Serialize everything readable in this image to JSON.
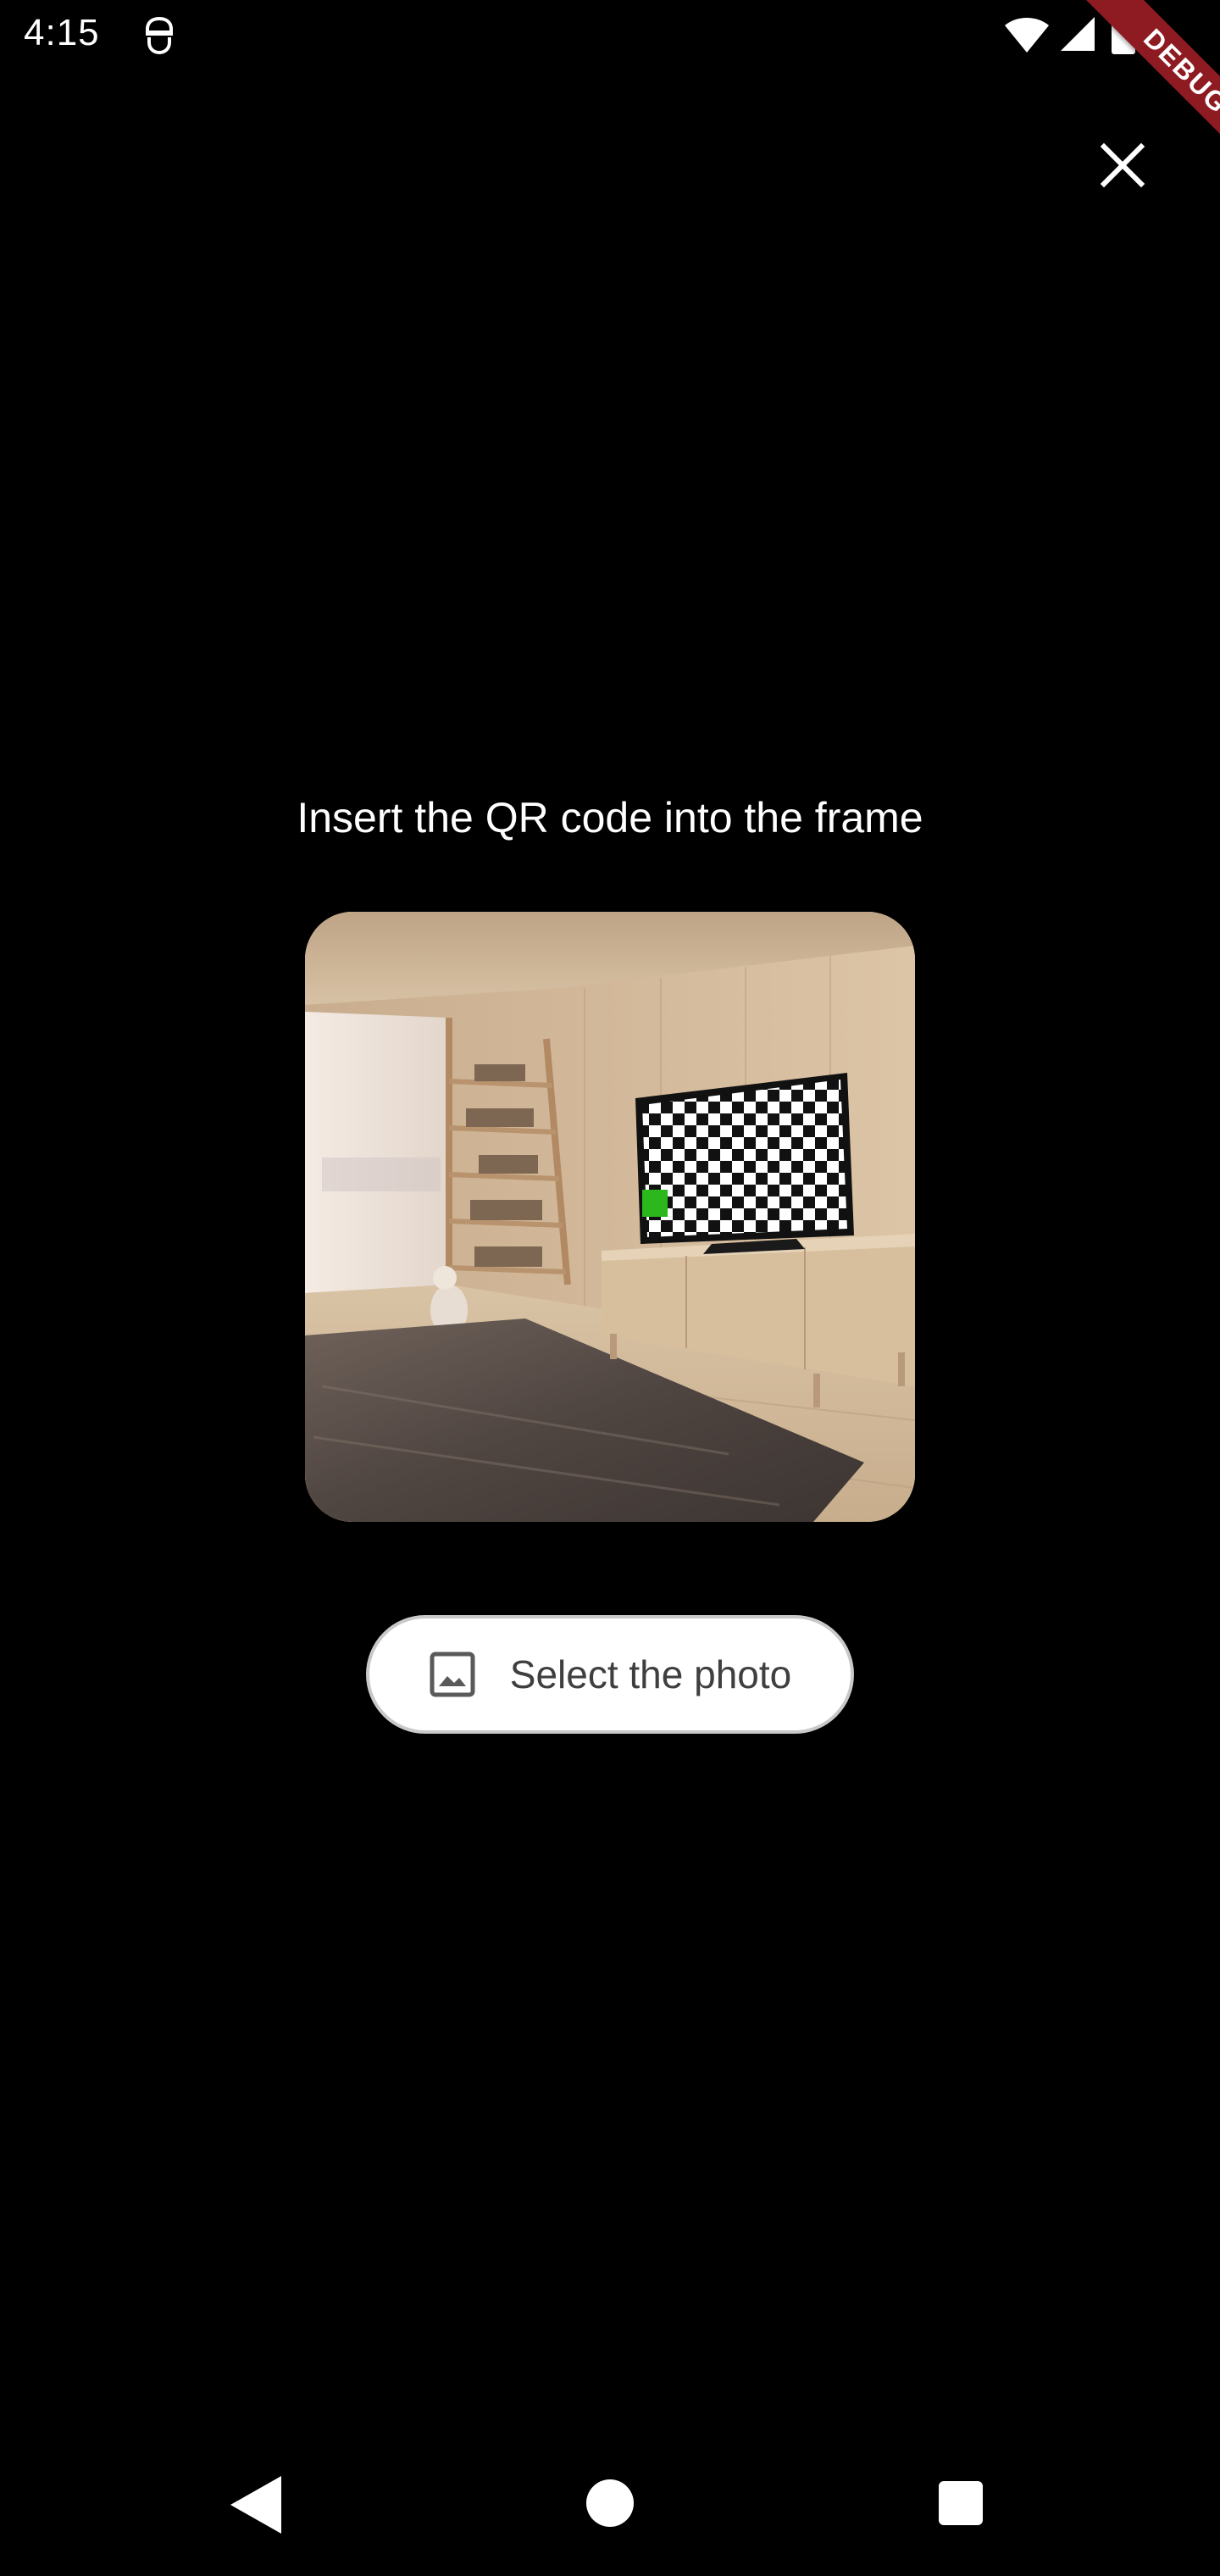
{
  "status_bar": {
    "time": "4:15",
    "icons": [
      "app-notification-icon",
      "wifi-icon",
      "cell-signal-icon",
      "battery-icon"
    ]
  },
  "debug_banner": {
    "label": "DEBUG",
    "color": "#8e1a22"
  },
  "close": {
    "icon": "close-icon"
  },
  "scanner": {
    "title": "Insert the QR code into the frame",
    "preview_description": "Room scene with bookshelf, window, cat, rug and a TV showing a checkerboard pattern"
  },
  "select_photo": {
    "label": "Select the photo",
    "icon": "image-icon"
  },
  "nav_bar": {
    "buttons": [
      "back-icon",
      "home-icon",
      "recents-icon"
    ]
  },
  "colors": {
    "background": "#000000",
    "text": "#ffffff",
    "button_bg": "#ffffff",
    "button_text": "#3f3f3f",
    "tv_marker": "#2ab81d"
  }
}
